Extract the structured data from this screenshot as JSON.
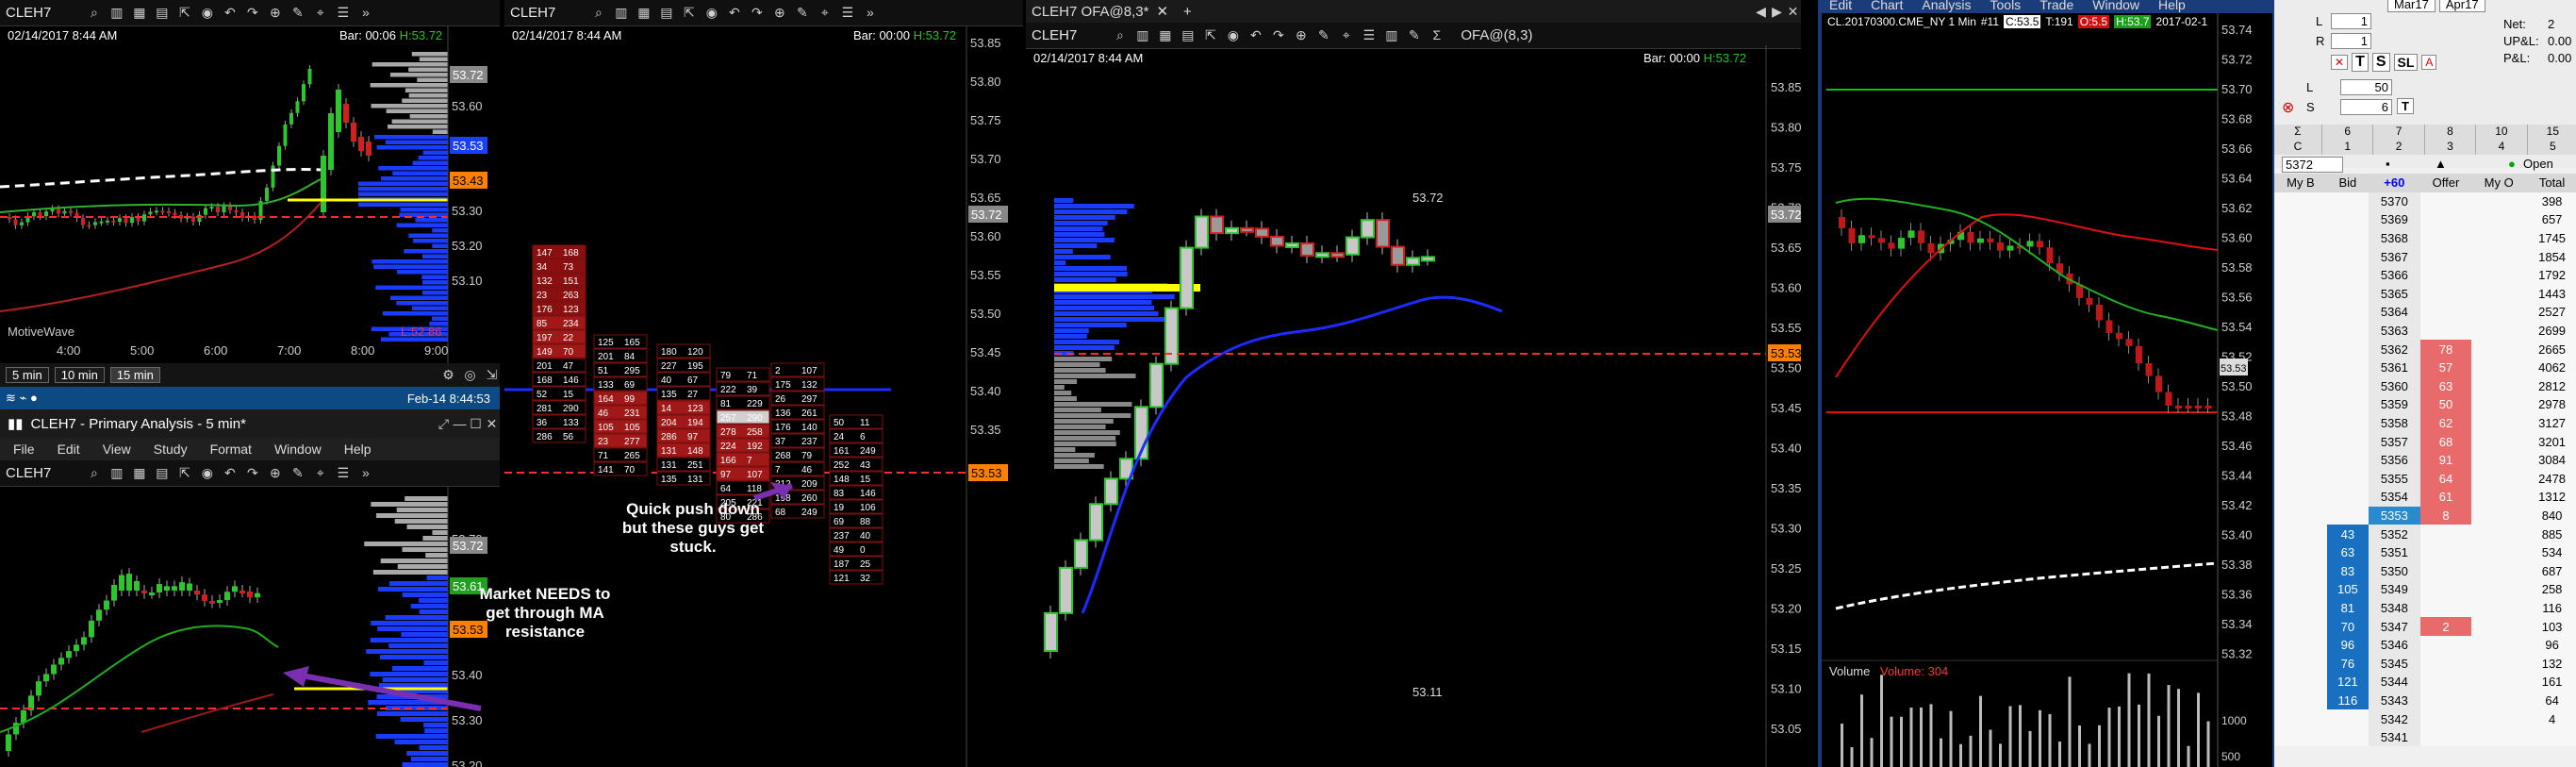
{
  "panel1": {
    "symbol": "CLEH7",
    "datetime": "02/14/2017 8:44 AM",
    "bar_label": "Bar: 00:06",
    "bar_high": "H:53.72",
    "ticks": [
      "53.70",
      "53.60",
      "53.50",
      "53.40",
      "53.30",
      "53.20",
      "53.10"
    ],
    "badges": {
      "top": "53.72",
      "mid": "53.53",
      "low": "53.43"
    },
    "times": [
      "4:00",
      "5:00",
      "6:00",
      "7:00",
      "8:00",
      "9:00"
    ],
    "brand": "MotiveWave",
    "low_label": "L:52.86",
    "intervals": [
      "5 min",
      "10 min",
      "15 min"
    ]
  },
  "panel2": {
    "symbol": "CLEH7",
    "datetime": "02/14/2017 8:44 AM",
    "bar_label": "Bar: 00:00",
    "bar_high": "H:53.72",
    "ticks": [
      "53.85",
      "53.80",
      "53.75",
      "53.70",
      "53.65",
      "53.60",
      "53.55",
      "53.50",
      "53.45",
      "53.40",
      "53.35"
    ],
    "badges": {
      "top": "53.72",
      "mid": "53.53"
    }
  },
  "status": {
    "timestamp": "Feb-14 8:44:53"
  },
  "window2": {
    "title": "CLEH7 - Primary Analysis - 5 min*",
    "menu": [
      "File",
      "Edit",
      "View",
      "Study",
      "Format",
      "Window",
      "Help"
    ],
    "symbol": "CLEH7",
    "ticks": [
      "53.70",
      "53.60",
      "53.50",
      "53.40",
      "53.30",
      "53.20"
    ],
    "badges": {
      "top": "53.72",
      "mid": "53.61",
      "low": "53.53"
    }
  },
  "annotations": {
    "market": "Market NEEDS to get through MA resistance",
    "push": "Quick push down but these guys get stuck."
  },
  "panel3": {
    "tab": "CLEH7 OFA@8,3*",
    "symbol": "CLEH7",
    "study": "OFA@(8,3)",
    "datetime": "02/14/2017 8:44 AM",
    "bar_label": "Bar: 00:00",
    "bar_high": "H:53.72",
    "ticks": [
      "53.85",
      "53.80",
      "53.75",
      "53.70",
      "53.65",
      "53.60",
      "53.55",
      "53.50",
      "53.45",
      "53.40",
      "53.35",
      "53.30",
      "53.25",
      "53.20",
      "53.15",
      "53.10",
      "53.05"
    ],
    "badges": {
      "top": "53.72",
      "mid": "53.53"
    },
    "hi_label": "53.72",
    "lo_label": "53.11"
  },
  "panel4": {
    "menu": [
      "Edit",
      "Chart",
      "Analysis",
      "Tools",
      "Trade",
      "Window",
      "Help"
    ],
    "title": "CL.20170300.CME_NY 1 Min",
    "num": "#11",
    "price_badge": "C:53.5",
    "ticks_info": "T:191",
    "tag1": "O:5.5",
    "tag2": "H:53.7",
    "date": "2017-02-1",
    "volume_label": "Volume",
    "volume_value": "Volume: 304",
    "ticks": [
      "53.74",
      "53.72",
      "53.70",
      "53.68",
      "53.66",
      "53.64",
      "53.62",
      "53.60",
      "53.58",
      "53.56",
      "53.54",
      "53.52",
      "53.50",
      "53.48",
      "53.46",
      "53.44",
      "53.42",
      "53.40",
      "53.38",
      "53.36",
      "53.34",
      "53.32"
    ],
    "price_badge_right": "53.53",
    "vol_ticks": [
      "1000",
      "500"
    ]
  },
  "dom": {
    "months": [
      "Mar17",
      "Apr17"
    ],
    "labels": {
      "l": "L",
      "r": "R",
      "net": "Net:",
      "upl": "UP&L:",
      "pl": "P&L:"
    },
    "values": {
      "net": "2",
      "upl": "0.00",
      "pl": "0.00",
      "l": "1",
      "r": "1",
      "qty_l": "50",
      "qty_s": "6"
    },
    "buttons": [
      "T",
      "S",
      "SL"
    ],
    "sigma_row": [
      "6",
      "7",
      "8",
      "10",
      "15"
    ],
    "c_row": [
      "1",
      "2",
      "3",
      "4",
      "5"
    ],
    "price_box": "5372",
    "open_label": "Open",
    "headers": [
      "My B",
      "Bid",
      "+60",
      "Offer",
      "My O",
      "Total"
    ],
    "rows": [
      {
        "price": "5370",
        "offer": "",
        "bid": "",
        "total": "398"
      },
      {
        "price": "5369",
        "offer": "",
        "bid": "",
        "total": "657"
      },
      {
        "price": "5368",
        "offer": "",
        "bid": "",
        "total": "1745"
      },
      {
        "price": "5367",
        "offer": "",
        "bid": "",
        "total": "1854"
      },
      {
        "price": "5366",
        "offer": "",
        "bid": "",
        "total": "1792"
      },
      {
        "price": "5365",
        "offer": "",
        "bid": "",
        "total": "1443"
      },
      {
        "price": "5364",
        "offer": "",
        "bid": "",
        "total": "2527"
      },
      {
        "price": "5363",
        "offer": "",
        "bid": "",
        "total": "2699"
      },
      {
        "price": "5362",
        "offer": "78",
        "bid": "",
        "total": "2665"
      },
      {
        "price": "5361",
        "offer": "57",
        "bid": "",
        "total": "4062"
      },
      {
        "price": "5360",
        "offer": "63",
        "bid": "",
        "total": "2812"
      },
      {
        "price": "5359",
        "offer": "50",
        "bid": "",
        "total": "2978"
      },
      {
        "price": "5358",
        "offer": "62",
        "bid": "",
        "total": "3127"
      },
      {
        "price": "5357",
        "offer": "68",
        "bid": "",
        "total": "3201"
      },
      {
        "price": "5356",
        "offer": "91",
        "bid": "",
        "total": "3084"
      },
      {
        "price": "5355",
        "offer": "64",
        "bid": "",
        "total": "2478"
      },
      {
        "price": "5354",
        "offer": "61",
        "bid": "",
        "total": "1312"
      },
      {
        "price": "5353",
        "offer": "8",
        "bid": "",
        "total": "840"
      },
      {
        "price": "5352",
        "offer": "",
        "bid": "43",
        "total": "885"
      },
      {
        "price": "5351",
        "offer": "",
        "bid": "63",
        "total": "534"
      },
      {
        "price": "5350",
        "offer": "",
        "bid": "83",
        "total": "687"
      },
      {
        "price": "5349",
        "offer": "",
        "bid": "105",
        "total": "258"
      },
      {
        "price": "5348",
        "offer": "",
        "bid": "81",
        "total": "116"
      },
      {
        "price": "5347",
        "offer": "2",
        "bid": "70",
        "total": "103"
      },
      {
        "price": "5346",
        "offer": "",
        "bid": "96",
        "total": "96"
      },
      {
        "price": "5345",
        "offer": "",
        "bid": "76",
        "total": "132"
      },
      {
        "price": "5344",
        "offer": "",
        "bid": "121",
        "total": "161"
      },
      {
        "price": "5343",
        "offer": "",
        "bid": "116",
        "total": "64"
      },
      {
        "price": "5342",
        "offer": "",
        "bid": "",
        "total": "4"
      },
      {
        "price": "5341",
        "offer": "",
        "bid": "",
        "total": ""
      }
    ]
  },
  "colors": {
    "bull": "#2ec52e",
    "bear": "#d02020",
    "ma": "#0000ff",
    "accent": "#ffff00"
  }
}
